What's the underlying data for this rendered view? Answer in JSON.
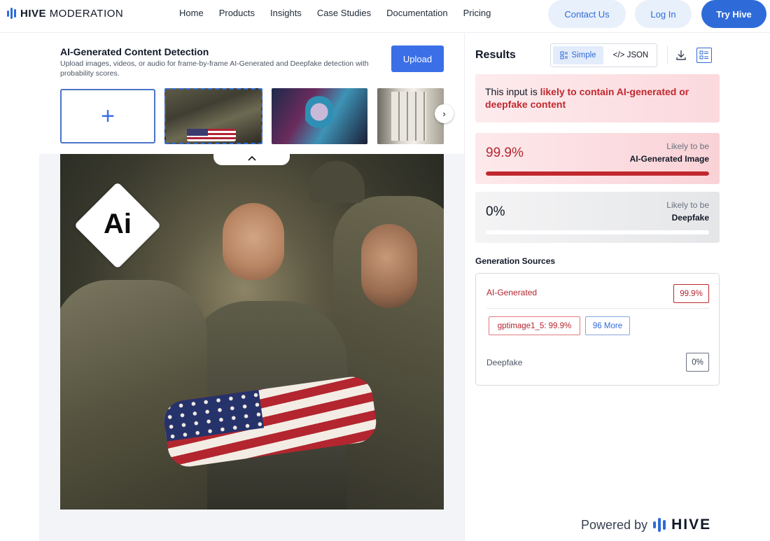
{
  "nav": {
    "logo_bold": "HIVE",
    "logo_light": "MODERATION",
    "links": [
      "Home",
      "Products",
      "Insights",
      "Case Studies",
      "Documentation",
      "Pricing"
    ],
    "contact": "Contact Us",
    "login": "Log In",
    "try": "Try Hive"
  },
  "detector": {
    "title": "AI-Generated Content Detection",
    "subtitle": "Upload images, videos, or audio for frame-by-frame AI-Generated and Deepfake detection with probability scores.",
    "upload": "Upload",
    "add_symbol": "+",
    "next_symbol": "›",
    "collapse_symbol": "^",
    "badge_text": "Ai"
  },
  "results": {
    "title": "Results",
    "toggle_simple": "Simple",
    "toggle_json": "</> JSON",
    "alert_prefix": "This input is ",
    "alert_emphasis": "likely to contain AI-generated or deepfake content",
    "ai": {
      "percent": "99.9%",
      "likely_label": "Likely to be",
      "category": "AI-Generated Image",
      "fraction": 0.999
    },
    "deepfake": {
      "percent": "0%",
      "likely_label": "Likely to be",
      "category": "Deepfake",
      "fraction": 0
    },
    "sources": {
      "title": "Generation Sources",
      "ai_label": "AI-Generated",
      "ai_value": "99.9%",
      "model_chip": "gptimage1_5: 99.9%",
      "more_chip": "96 More",
      "deepfake_label": "Deepfake",
      "deepfake_value": "0%"
    },
    "powered_by": "Powered by",
    "powered_brand": "HIVE"
  },
  "colors": {
    "accent": "#2f6bd8",
    "alert_red": "#c0282e"
  }
}
